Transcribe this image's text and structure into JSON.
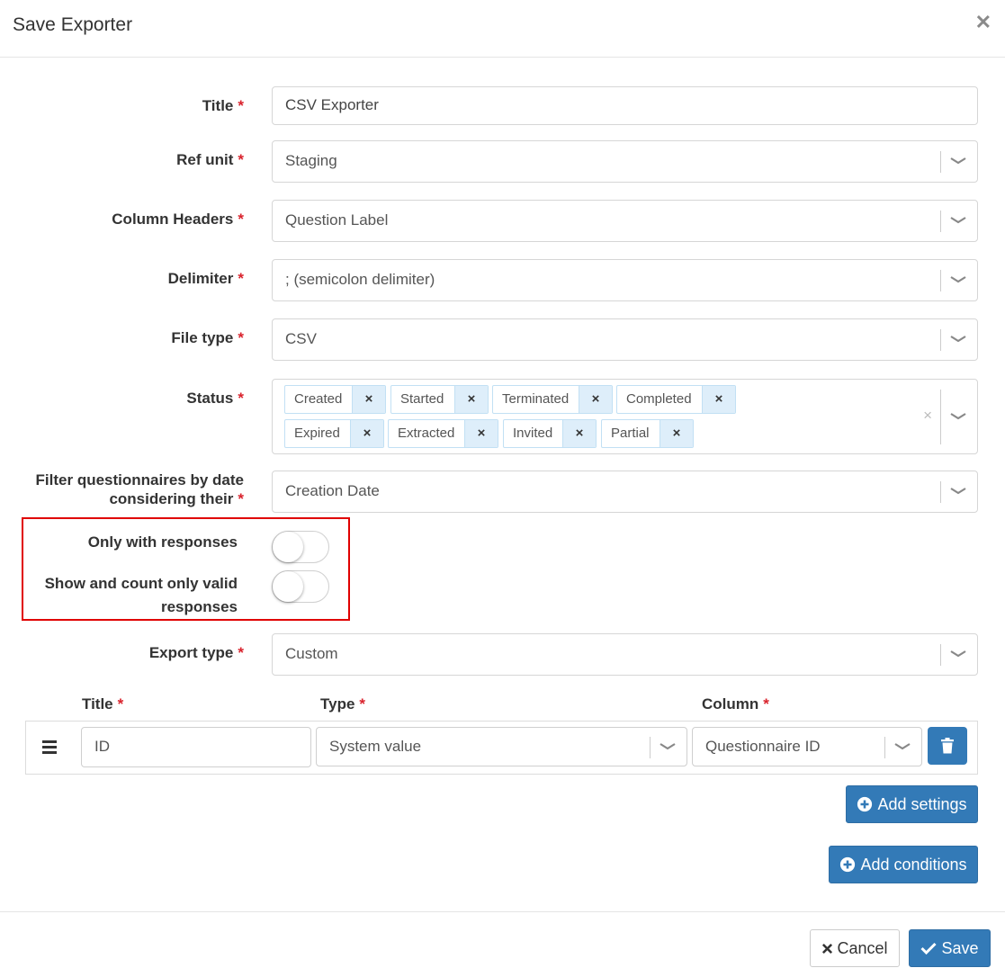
{
  "modal": {
    "title": "Save Exporter",
    "close_icon": "close-icon"
  },
  "form": {
    "required_mark": "*",
    "title": {
      "label": "Title",
      "value": "CSV Exporter"
    },
    "ref_unit": {
      "label": "Ref unit",
      "value": "Staging"
    },
    "column_headers": {
      "label": "Column Headers",
      "value": "Question Label"
    },
    "delimiter": {
      "label": "Delimiter",
      "value": "; (semicolon delimiter)"
    },
    "file_type": {
      "label": "File type",
      "value": "CSV"
    },
    "status": {
      "label": "Status",
      "tags": [
        "Created",
        "Started",
        "Terminated",
        "Completed",
        "Expired",
        "Extracted",
        "Invited",
        "Partial"
      ],
      "tag_remove": "×",
      "clear": "×"
    },
    "filter_date": {
      "label_line1": "Filter questionnaires by date",
      "label_line2": "considering their",
      "value": "Creation Date"
    },
    "only_with_responses": {
      "label": "Only with responses",
      "enabled": false
    },
    "valid_responses": {
      "label_line1": "Show and count only valid",
      "label_line2": "responses",
      "enabled": false
    },
    "export_type": {
      "label": "Export type",
      "value": "Custom"
    }
  },
  "custom_columns": {
    "headers": {
      "title": "Title",
      "type": "Type",
      "column": "Column"
    },
    "rows": [
      {
        "title": "ID",
        "type": "System value",
        "column": "Questionnaire ID"
      }
    ]
  },
  "buttons": {
    "add_settings": "Add settings",
    "add_conditions": "Add conditions",
    "cancel": "Cancel",
    "save": "Save"
  },
  "colors": {
    "primary": "#337ab7",
    "required": "#d9232d",
    "highlight": "#e00000",
    "tag_bg": "#deeefa"
  },
  "icons": [
    "close-icon",
    "chevron-down-icon",
    "remove-tag-icon",
    "drag-handle-icon",
    "trash-icon",
    "plus-circle-icon",
    "times-icon",
    "check-icon"
  ]
}
